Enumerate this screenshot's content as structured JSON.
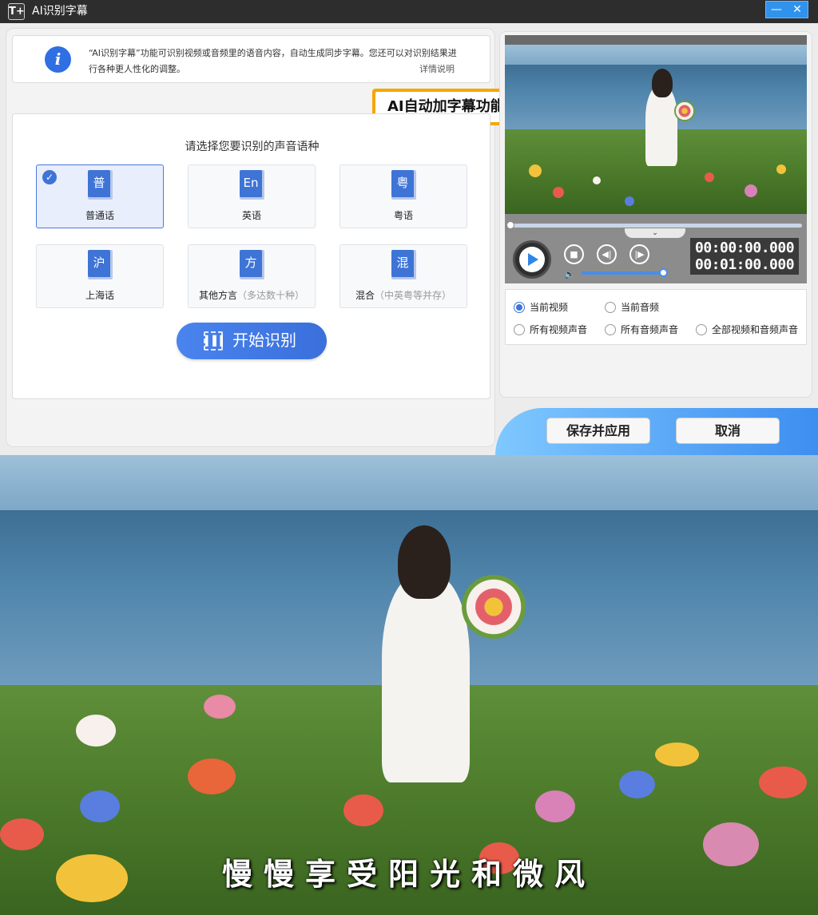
{
  "window": {
    "logo_text": "T+",
    "title": "AI识别字幕",
    "minimize": "—",
    "close": "✕"
  },
  "info": {
    "icon": "i",
    "text": "“AI识别字幕”功能可识别视频或音频里的语音内容，自动生成同步字幕。您还可以对识别结果进行各种更人性化的调整。",
    "detail_link": "详情说明"
  },
  "callout": {
    "text": "AI自动加字幕功能"
  },
  "language": {
    "prompt": "请选择您要识别的声音语种",
    "options": [
      {
        "glyph": "普",
        "label": "普通话",
        "note": "",
        "selected": true
      },
      {
        "glyph": "En",
        "label": "英语",
        "note": "",
        "selected": false
      },
      {
        "glyph": "粤",
        "label": "粤语",
        "note": "",
        "selected": false
      },
      {
        "glyph": "沪",
        "label": "上海话",
        "note": "",
        "selected": false
      },
      {
        "glyph": "方",
        "label": "其他方言",
        "note": "（多达数十种）",
        "selected": false
      },
      {
        "glyph": "混",
        "label": "混合",
        "note": "（中英粤等并存）",
        "selected": false
      }
    ],
    "check_mark": "✓",
    "start_button": "开始识别"
  },
  "player": {
    "time_current": "00:00:00.000",
    "time_total": "00:01:00.000",
    "collapse": "⌄",
    "stop": "■",
    "prev": "◀|",
    "next": "|▶",
    "volume": "🔈",
    "volume_level": 0.95,
    "progress": 0.0
  },
  "source": {
    "options": [
      {
        "label": "当前视频",
        "checked": true
      },
      {
        "label": "当前音频",
        "checked": false
      },
      {
        "label": "所有视频声音",
        "checked": false
      },
      {
        "label": "所有音频声音",
        "checked": false
      },
      {
        "label": "全部视频和音频声音",
        "checked": false
      }
    ]
  },
  "footer": {
    "save_apply": "保存并应用",
    "cancel": "取消"
  },
  "output": {
    "subtitle": "慢慢享受阳光和微风"
  },
  "colors": {
    "accent": "#3e74d6",
    "callout": "#f5a700",
    "titlebar": "#2d2d2d"
  }
}
